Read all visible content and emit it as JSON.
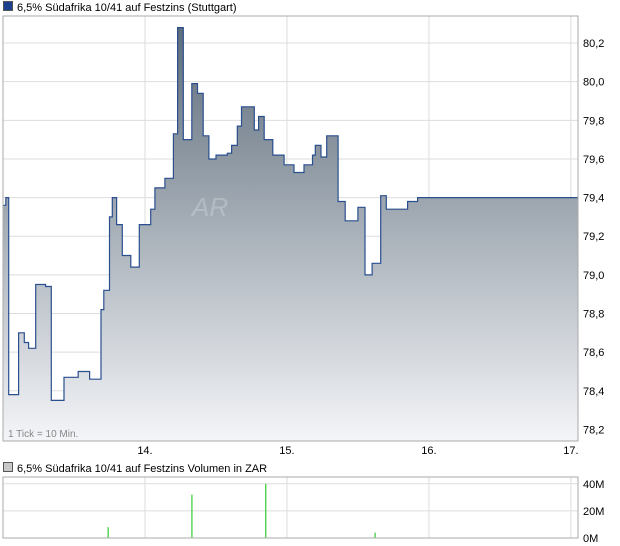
{
  "colors": {
    "price_line": "#2a4f8e",
    "fill_top": "#5e6d7b",
    "fill_bottom": "#f4f5f8",
    "volume_bar": "#33cc33",
    "grid": "#dddddd",
    "border": "#aaaaaa",
    "price_swatch": "#1f3f8f",
    "volume_swatch": "#c8c8c8"
  },
  "note": "1 Tick = 10 Min.",
  "watermark": "AR",
  "chart_data": [
    {
      "type": "area",
      "title": "6,5% Südafrika 10/41 auf Festzins (Stuttgart)",
      "xlabel": "",
      "ylabel": "",
      "x_ticks": [
        "14.",
        "15.",
        "16.",
        "17."
      ],
      "x_range": [
        0,
        4.05
      ],
      "ylim": [
        78.14,
        80.34
      ],
      "y_ticks": [
        "80,2",
        "80,0",
        "79,8",
        "79,6",
        "79,4",
        "79,2",
        "79,0",
        "78,8",
        "78,6",
        "78,4",
        "78,2"
      ],
      "grid": true,
      "x": [
        0.0,
        0.02,
        0.04,
        0.06,
        0.11,
        0.13,
        0.15,
        0.18,
        0.21,
        0.23,
        0.3,
        0.34,
        0.37,
        0.43,
        0.45,
        0.48,
        0.53,
        0.61,
        0.69,
        0.71,
        0.75,
        0.77,
        0.78,
        0.8,
        0.84,
        0.9,
        0.93,
        0.96,
        0.98,
        1.01,
        1.04,
        1.07,
        1.1,
        1.14,
        1.18,
        1.2,
        1.23,
        1.27,
        1.31,
        1.33,
        1.37,
        1.41,
        1.45,
        1.5,
        1.55,
        1.58,
        1.61,
        1.65,
        1.68,
        1.73,
        1.77,
        1.8,
        1.84,
        1.9,
        1.98,
        2.05,
        2.12,
        2.18,
        2.2,
        2.24,
        2.28,
        2.31,
        2.36,
        2.41,
        2.46,
        2.5,
        2.55,
        2.6,
        2.63,
        2.66,
        2.7,
        2.75,
        2.8,
        2.85,
        2.88,
        2.92,
        2.97,
        3.02,
        3.08,
        3.14,
        3.19,
        3.24,
        3.29,
        3.33,
        3.38,
        3.42,
        3.47,
        3.52,
        3.6,
        3.65,
        3.72,
        3.85,
        4.0,
        4.05
      ],
      "y": [
        79.36,
        79.4,
        78.38,
        78.38,
        78.7,
        78.7,
        78.65,
        78.62,
        78.62,
        78.95,
        78.94,
        78.35,
        78.35,
        78.47,
        78.47,
        78.47,
        78.5,
        78.46,
        78.82,
        78.92,
        79.3,
        79.4,
        79.4,
        79.26,
        79.1,
        79.04,
        79.04,
        79.26,
        79.26,
        79.26,
        79.34,
        79.45,
        79.45,
        79.5,
        79.5,
        79.73,
        80.28,
        79.7,
        79.7,
        79.99,
        79.94,
        79.72,
        79.6,
        79.62,
        79.62,
        79.63,
        79.67,
        79.77,
        79.87,
        79.87,
        79.75,
        79.82,
        79.7,
        79.62,
        79.57,
        79.53,
        79.57,
        79.62,
        79.67,
        79.61,
        79.72,
        79.72,
        79.38,
        79.28,
        79.28,
        79.35,
        79.0,
        79.06,
        79.06,
        79.41,
        79.34,
        79.34,
        79.34,
        79.38,
        79.38,
        79.4,
        79.4,
        79.4,
        79.4,
        79.4,
        79.4,
        79.4,
        79.4,
        79.4,
        79.4,
        79.4,
        79.4,
        79.4,
        79.4,
        79.4,
        79.4,
        79.4,
        79.4,
        79.4
      ]
    },
    {
      "type": "bar",
      "title": "6,5% Südafrika 10/41 auf Festzins Volumen in ZAR",
      "xlabel": "",
      "ylabel": "",
      "ylim": [
        0,
        45000000
      ],
      "y_ticks": [
        "40M",
        "20M",
        "0M"
      ],
      "grid": true,
      "x": [
        0.74,
        1.33,
        1.85,
        2.62
      ],
      "values": [
        8000000,
        32000000,
        40000000,
        4000000
      ]
    }
  ]
}
